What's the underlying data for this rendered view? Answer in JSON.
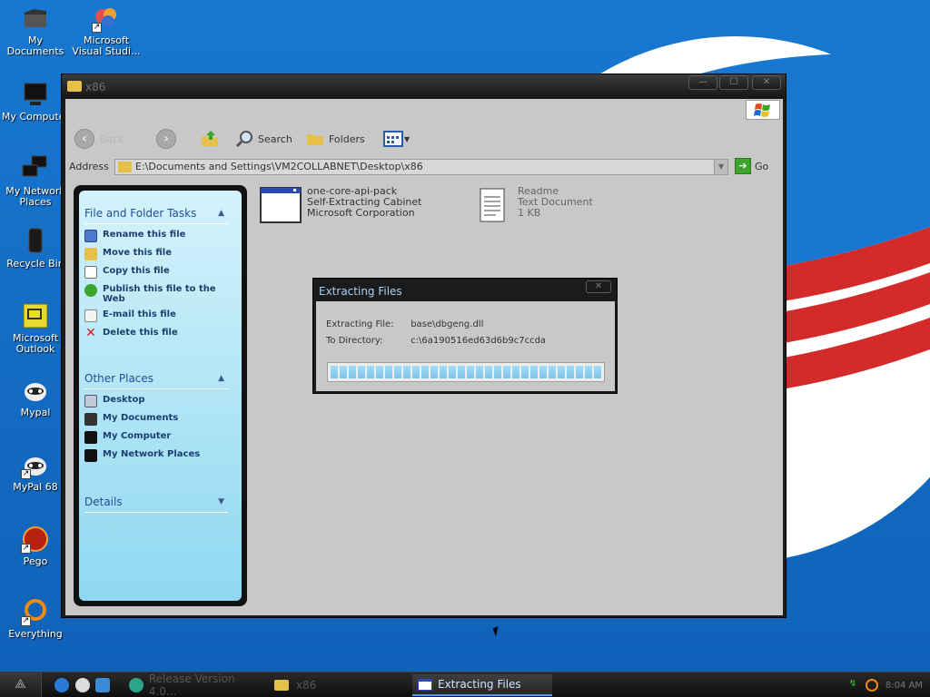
{
  "desktop": {
    "icons": [
      {
        "label": "My Documents",
        "icon": "my-documents-icon"
      },
      {
        "label": "Microsoft Visual Studi...",
        "icon": "visual-studio-icon",
        "shortcut": true
      },
      {
        "label": "My Computer",
        "icon": "my-computer-icon"
      },
      {
        "label": "My Network Places",
        "icon": "network-places-icon"
      },
      {
        "label": "Recycle Bin",
        "icon": "recycle-bin-icon"
      },
      {
        "label": "Microsoft Outlook",
        "icon": "outlook-icon"
      },
      {
        "label": "Mypal",
        "icon": "mypal-icon"
      },
      {
        "label": "MyPal 68",
        "icon": "mypal68-icon",
        "shortcut": true
      },
      {
        "label": "Pego",
        "icon": "pego-icon",
        "shortcut": true
      },
      {
        "label": "Everything",
        "icon": "everything-icon",
        "shortcut": true
      }
    ]
  },
  "explorer": {
    "title": "x86",
    "toolbar": {
      "back_label": "Back",
      "search_label": "Search",
      "folders_label": "Folders"
    },
    "address": {
      "label": "Address",
      "value": "E:\\Documents and Settings\\VM2COLLABNET\\Desktop\\x86",
      "go_label": "Go"
    },
    "taskpane": {
      "file_tasks": {
        "heading": "File and Folder Tasks",
        "items": [
          "Rename this file",
          "Move this file",
          "Copy this file",
          "Publish this file to the Web",
          "E-mail this file",
          "Delete this file"
        ]
      },
      "other_places": {
        "heading": "Other Places",
        "items": [
          "Desktop",
          "My Documents",
          "My Computer",
          "My Network Places"
        ]
      },
      "details": {
        "heading": "Details"
      }
    },
    "files": [
      {
        "name": "one-core-api-pack",
        "type": "Self-Extracting Cabinet",
        "info": "Microsoft Corporation"
      },
      {
        "name": "Readme",
        "type": "Text Document",
        "info": "1 KB"
      }
    ]
  },
  "dialog": {
    "title": "Extracting Files",
    "file_label": "Extracting File:",
    "file_value": "base\\dbgeng.dll",
    "dir_label": "To Directory:",
    "dir_value": "c:\\6a190516ed63d6b9c7ccda",
    "progress_fraction": 1.0
  },
  "taskbar": {
    "tasks": [
      {
        "label": "Release Version 4.0...",
        "active": false
      },
      {
        "label": "x86",
        "active": false
      },
      {
        "label": "Extracting Files",
        "active": true
      }
    ],
    "clock": "8:04 AM"
  },
  "colors": {
    "desktop_blue": "#1877d0",
    "window_frame": "#1d1d1d",
    "window_face": "#c8c8c8",
    "taskpane_blue": "#8fd8f1",
    "progress_blue": "#7cc4ec",
    "dialog_title": "#aad0f4"
  }
}
